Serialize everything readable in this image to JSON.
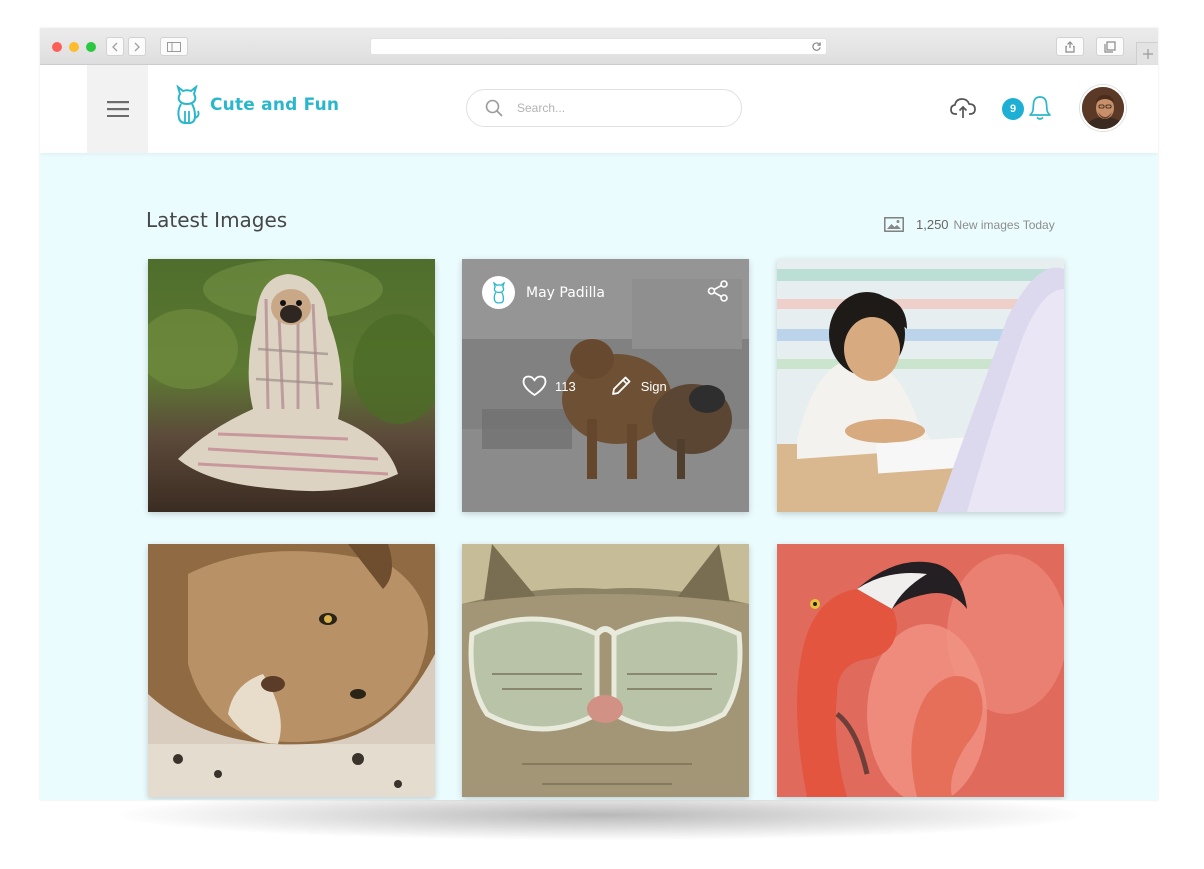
{
  "header": {
    "brand": "Cute and Fun",
    "search_placeholder": "Search...",
    "notification_count": "9"
  },
  "main": {
    "section_title": "Latest Images",
    "stats_count": "1,250",
    "stats_label": "New images Today"
  },
  "cards": [
    {
      "subject": "pug wrapped in plaid blanket"
    },
    {
      "subject": "dogs on a bench",
      "hover": {
        "user": "May Padilla",
        "likes": "113",
        "action_label": "Sign"
      }
    },
    {
      "subject": "child reading at a desk"
    },
    {
      "subject": "lion lying on the ground"
    },
    {
      "subject": "cat wearing glasses"
    },
    {
      "subject": "flamingos"
    }
  ],
  "colors": {
    "accent": "#2ab7cc",
    "badge": "#1eb0d4",
    "page_background": "#ebfcfe"
  },
  "icons": [
    "menu-icon",
    "cat-logo-icon",
    "search-icon",
    "upload-cloud-icon",
    "bell-icon",
    "image-icon",
    "share-icon",
    "heart-icon",
    "pencil-icon"
  ]
}
